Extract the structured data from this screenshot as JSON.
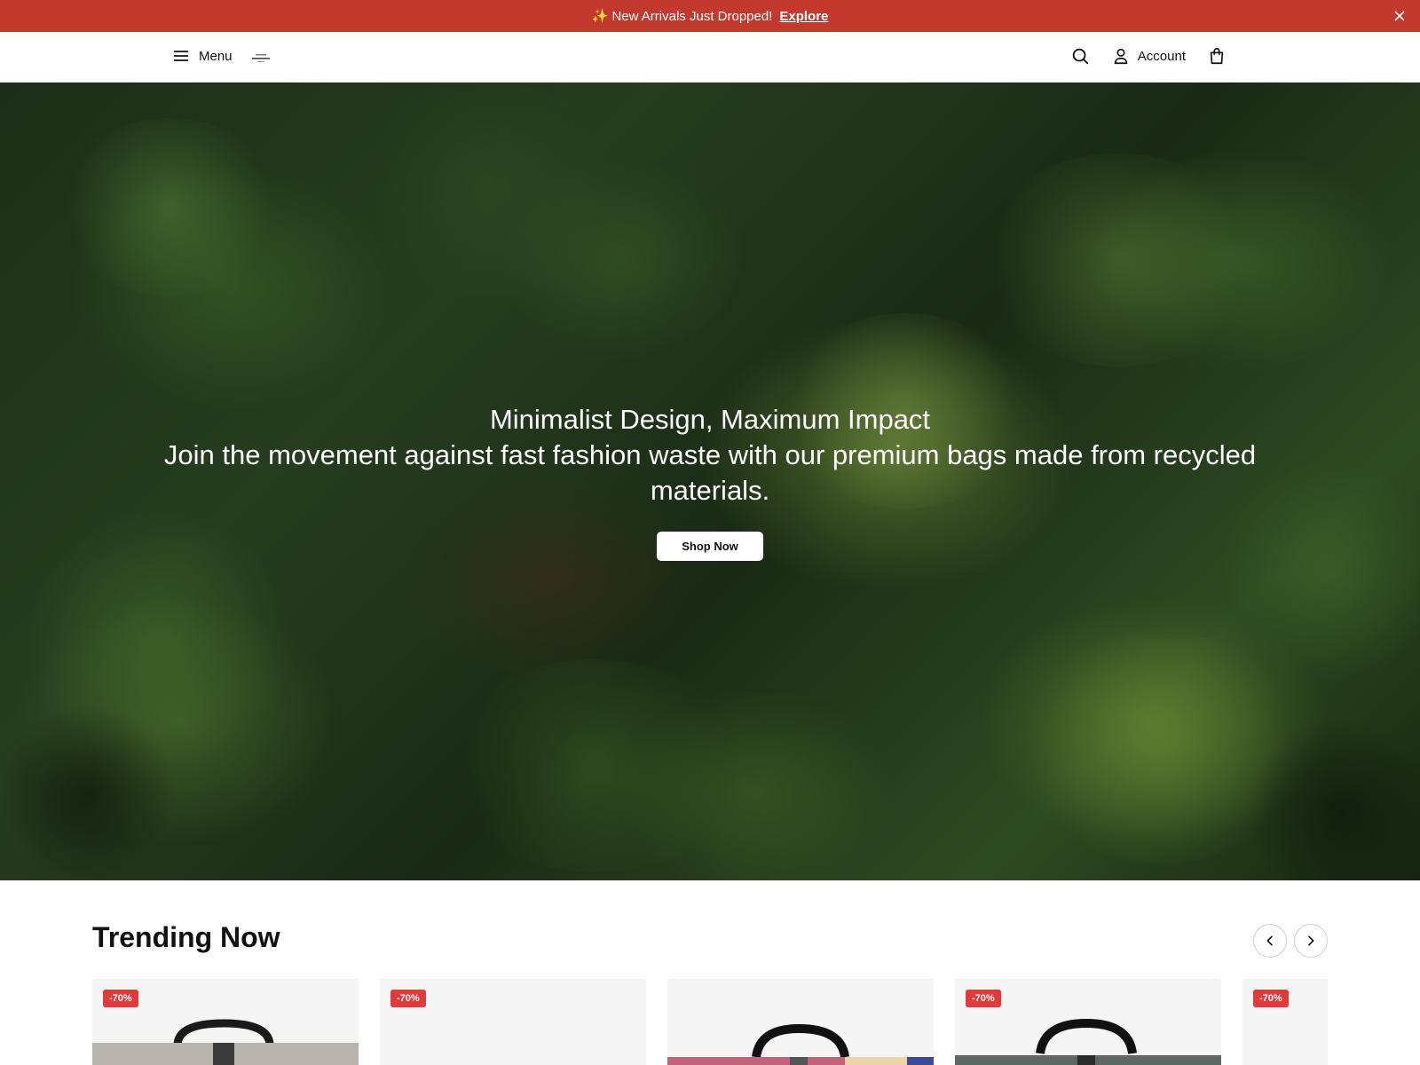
{
  "announcement": {
    "message": "✨ New Arrivals Just Dropped!",
    "link": "Explore"
  },
  "header": {
    "menu_label": "Menu",
    "account_label": "Account"
  },
  "hero": {
    "title": "Minimalist Design, Maximum Impact",
    "subtitle": "Join the movement against fast fashion waste with our premium bags made from recycled materials.",
    "cta": "Shop Now"
  },
  "trending": {
    "title": "Trending Now",
    "products": [
      {
        "badge": "-70%",
        "color": "#b8b5ae"
      },
      {
        "badge": "-70%",
        "color": "#f5f5f6"
      },
      {
        "badge": "",
        "color": "#c4607a"
      },
      {
        "badge": "-70%",
        "color": "#5c6866"
      },
      {
        "badge": "-70%",
        "color": "#f5f5f6"
      }
    ]
  },
  "colors": {
    "announcement_bg": "#c4392d",
    "badge_bg": "#e23a3a"
  }
}
